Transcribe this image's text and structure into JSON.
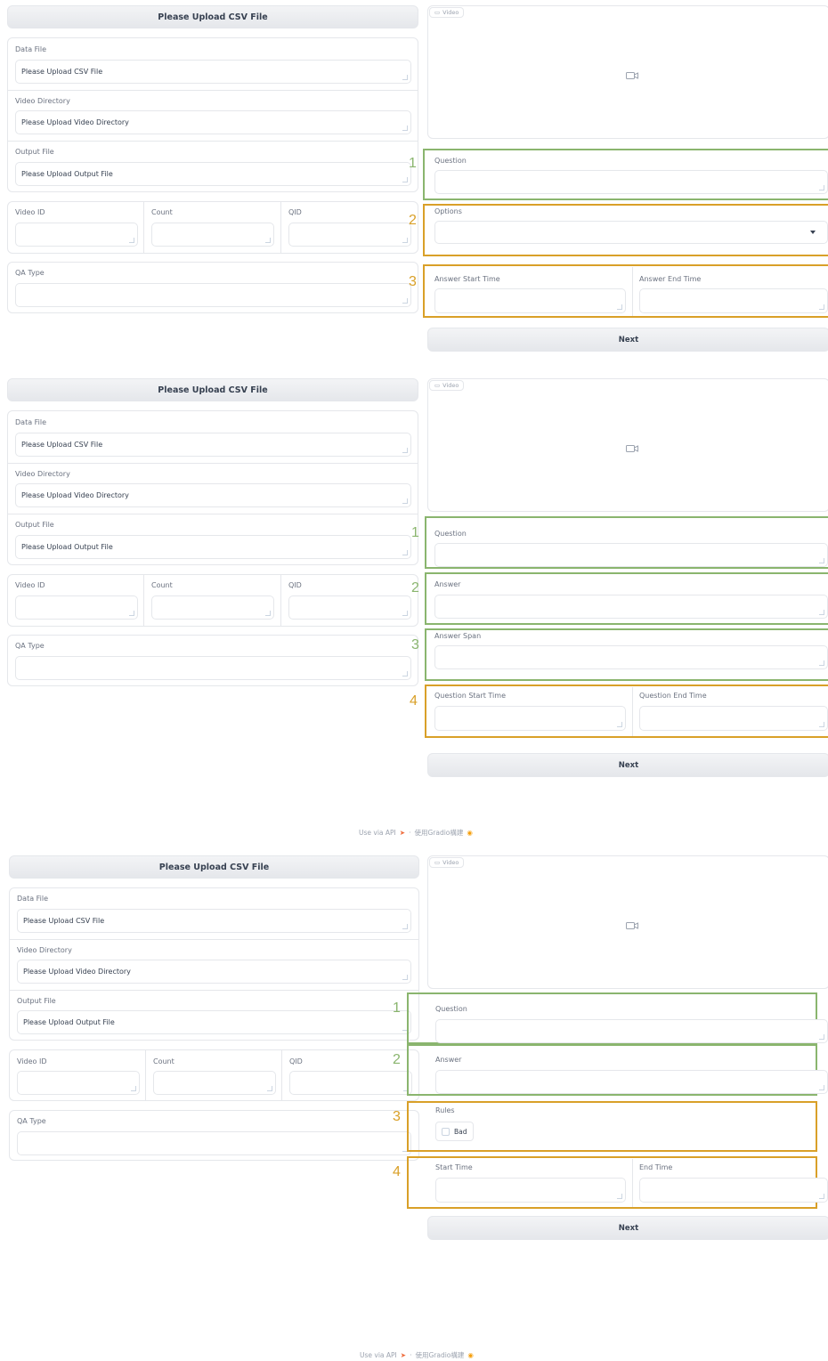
{
  "left": {
    "upload_button": "Please Upload CSV File",
    "data_file_label": "Data File",
    "data_file_value": "Please Upload CSV File",
    "video_dir_label": "Video Directory",
    "video_dir_value": "Please Upload Video Directory",
    "output_file_label": "Output File",
    "output_file_value": "Please Upload Output File",
    "video_id_label": "Video ID",
    "count_label": "Count",
    "qid_label": "QID",
    "qa_type_label": "QA Type"
  },
  "video": {
    "tag": "Video"
  },
  "next_label": "Next",
  "panel1": {
    "question_label": "Question",
    "options_label": "Options",
    "answer_start_label": "Answer Start Time",
    "answer_end_label": "Answer End Time",
    "numbers": [
      "1",
      "2",
      "3"
    ]
  },
  "panel2": {
    "question_label": "Question",
    "answer_label": "Answer",
    "answer_span_label": "Answer Span",
    "question_start_label": "Question Start Time",
    "question_end_label": "Question End Time",
    "numbers": [
      "1",
      "2",
      "3",
      "4"
    ]
  },
  "panel3": {
    "question_label": "Question",
    "answer_label": "Answer",
    "rules_label": "Rules",
    "bad_label": "Bad",
    "start_label": "Start Time",
    "end_label": "End Time",
    "numbers": [
      "1",
      "2",
      "3",
      "4"
    ]
  },
  "footer": {
    "api": "Use via API",
    "sep": "·",
    "built": "使用Gradio構建"
  },
  "colors": {
    "green": "#8ab56e",
    "orange": "#d9a028"
  },
  "icons": {
    "video": "video-camera-icon",
    "rocket": "rocket-icon",
    "gradio": "gradio-logo-icon",
    "dropdown": "caret-down-icon"
  }
}
